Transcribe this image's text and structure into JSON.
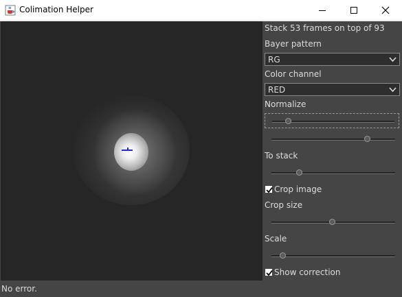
{
  "window": {
    "title": "Colimation Helper",
    "icon": "java-cup-icon",
    "controls": [
      "minimize-icon",
      "maximize-icon",
      "close-icon"
    ]
  },
  "viewport": {
    "background_color": "#262626",
    "marker_color": "#1f2bd6"
  },
  "panel": {
    "stack_info": "Stack 53 frames on top of 93",
    "bayer_label": "Bayer pattern",
    "bayer_value": "RG",
    "channel_label": "Color channel",
    "channel_value": "RED",
    "normalize_label": "Normalize",
    "normalize_low": 0.13,
    "normalize_high": 0.77,
    "to_stack_label": "To stack",
    "to_stack_value": 0.22,
    "crop_image_label": "Crop image",
    "crop_image_checked": true,
    "crop_size_label": "Crop size",
    "crop_size_value": 0.49,
    "scale_label": "Scale",
    "scale_value": 0.09,
    "show_correction_label": "Show correction",
    "show_correction_checked": true
  },
  "status": {
    "text": "No error."
  }
}
